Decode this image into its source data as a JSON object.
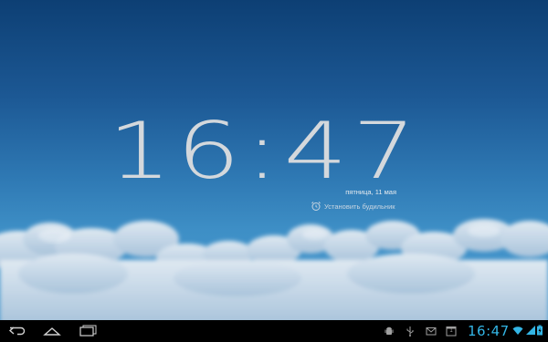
{
  "lockscreen": {
    "time": "16:47",
    "date": "пятница, 11 мая",
    "alarm_label": "Установить будильник"
  },
  "statusbar": {
    "time": "16:47",
    "notifications": [
      "android-debug-icon",
      "usb-icon",
      "gmail-icon",
      "calendar-icon"
    ],
    "calendar_day": "1"
  },
  "navbar": {
    "buttons": [
      "back-button",
      "home-button",
      "recent-apps-button"
    ]
  },
  "colors": {
    "holo_blue": "#33b5e5",
    "clock_text": "#d4d8dc",
    "sky_top": "#0d3f74",
    "sky_bottom": "#4a9ad0"
  }
}
